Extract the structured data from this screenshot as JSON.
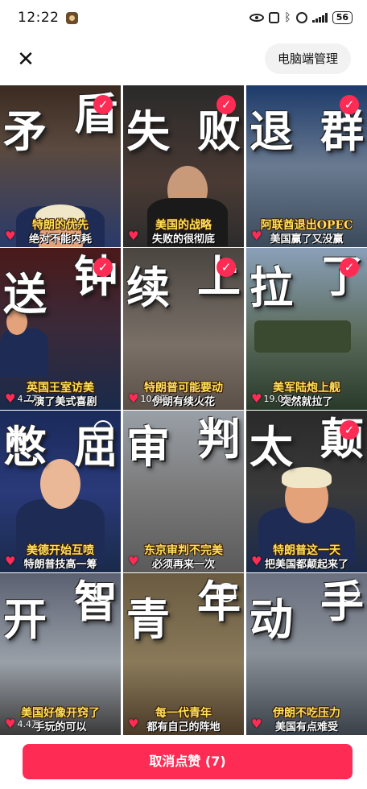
{
  "status_bar": {
    "time": "12:22",
    "battery": "56",
    "icons": [
      "notification-icon",
      "eye-icon",
      "nfc-icon",
      "bluetooth-icon",
      "vibrate-icon",
      "signal-icon",
      "battery-icon"
    ]
  },
  "header": {
    "close_icon": "close-icon",
    "pc_manage_label": "电脑端管理"
  },
  "tiles": [
    {
      "char1": "矛",
      "char2": "盾",
      "caption": "特朗的优先",
      "subtitle": "绝对不能内耗",
      "count": "",
      "checked": true
    },
    {
      "char1": "失",
      "char2": "败",
      "caption": "美国的战略",
      "subtitle": "失败的很彻底",
      "count": "",
      "checked": true
    },
    {
      "char1": "退",
      "char2": "群",
      "caption": "阿联酋退出OPEC",
      "subtitle": "美国赢了又没赢",
      "count": "",
      "checked": true
    },
    {
      "char1": "送",
      "char2": "钟",
      "caption": "英国王室访美",
      "subtitle": "一演了美式喜剧",
      "count": "4.7万",
      "checked": true
    },
    {
      "char1": "续",
      "char2": "上",
      "caption": "特朗普可能要动",
      "subtitle": "伊朗有续火花",
      "count": "10.6万",
      "checked": true
    },
    {
      "char1": "拉",
      "char2": "了",
      "caption": "美军陆炮上舰",
      "subtitle": "突然就拉了",
      "count": "19.0万",
      "checked": true
    },
    {
      "char1": "憋",
      "char2": "屈",
      "caption": "美德开始互喷",
      "subtitle": "特朗普技高一筹",
      "count": "",
      "checked": false
    },
    {
      "char1": "审",
      "char2": "判",
      "caption": "东京审判不完美",
      "subtitle": "必须再来一次",
      "count": "",
      "checked": false
    },
    {
      "char1": "太",
      "char2": "颠",
      "caption": "特朗普这一天",
      "subtitle": "把美国都颠起来了",
      "count": "",
      "checked": true
    },
    {
      "char1": "开",
      "char2": "智",
      "caption": "美国好像开窍了",
      "subtitle": "手玩的可以",
      "count": "4.4万",
      "checked": false
    },
    {
      "char1": "青",
      "char2": "年",
      "caption": "每一代青年",
      "subtitle": "都有自己的阵地",
      "count": "",
      "checked": false
    },
    {
      "char1": "动",
      "char2": "手",
      "caption": "伊朗不吃压力",
      "subtitle": "美国有点难受",
      "count": "",
      "checked": false
    }
  ],
  "bottom": {
    "unlike_label": "取消点赞 (7)"
  },
  "colors": {
    "accent": "#fe2c55",
    "caption_yellow": "#ffe15a",
    "pill_bg": "#f2f2f2"
  }
}
